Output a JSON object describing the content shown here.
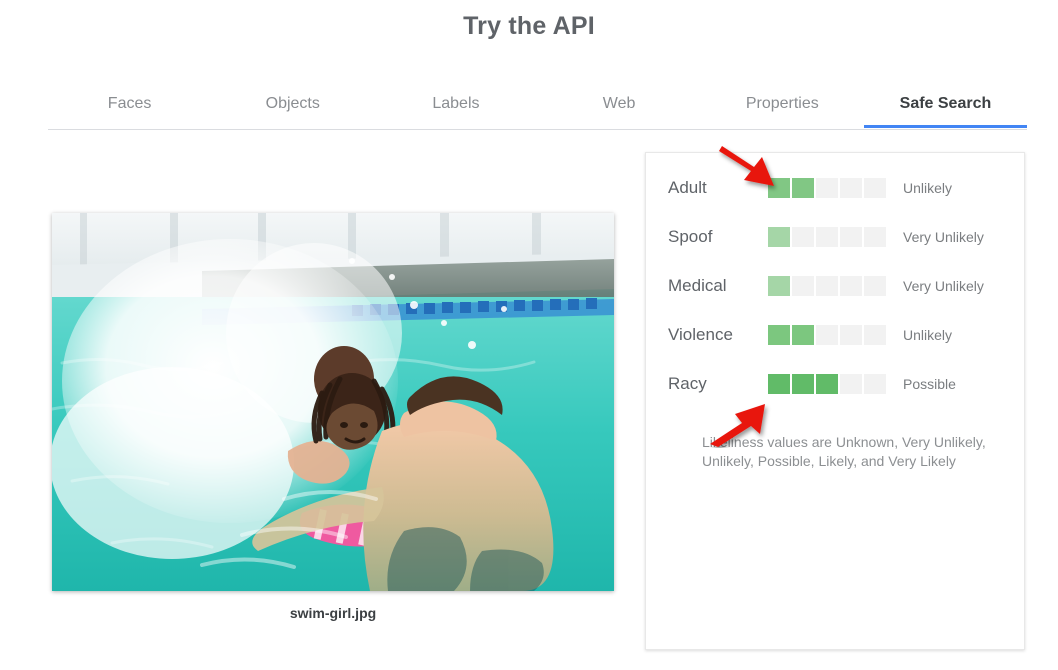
{
  "header": {
    "title": "Try the API"
  },
  "tabs": [
    {
      "label": "Faces",
      "active": false
    },
    {
      "label": "Objects",
      "active": false
    },
    {
      "label": "Labels",
      "active": false
    },
    {
      "label": "Web",
      "active": false
    },
    {
      "label": "Properties",
      "active": false
    },
    {
      "label": "Safe Search",
      "active": true
    }
  ],
  "image_panel": {
    "filename": "swim-girl.jpg",
    "alt": "swimming pool with girl swimming and man in water"
  },
  "safe_search": {
    "segment_count": 5,
    "rows": [
      {
        "label": "Adult",
        "value": "Unlikely",
        "filled": 2,
        "fill_color": "#81c784"
      },
      {
        "label": "Spoof",
        "value": "Very Unlikely",
        "filled": 1,
        "fill_color": "#a5d6a7"
      },
      {
        "label": "Medical",
        "value": "Very Unlikely",
        "filled": 1,
        "fill_color": "#a5d6a7"
      },
      {
        "label": "Violence",
        "value": "Unlikely",
        "filled": 2,
        "fill_color": "#7cc77f"
      },
      {
        "label": "Racy",
        "value": "Possible",
        "filled": 3,
        "fill_color": "#61bb68"
      }
    ],
    "note": "Likeliness values are Unknown, Very Unlikely, Unlikely, Possible, Likely, and Very Likely"
  },
  "annotations": [
    {
      "name": "arrow-pointing-to-adult-bar",
      "color": "#e8170f",
      "direction": "down-right"
    },
    {
      "name": "arrow-pointing-to-racy-bar",
      "color": "#e8170f",
      "direction": "up-right"
    }
  ],
  "colors": {
    "accent_blue": "#4285f4",
    "text_primary": "#3c4043",
    "text_muted": "#8a8d91",
    "track": "#f2f2f2",
    "arrow_red": "#e8170f"
  }
}
